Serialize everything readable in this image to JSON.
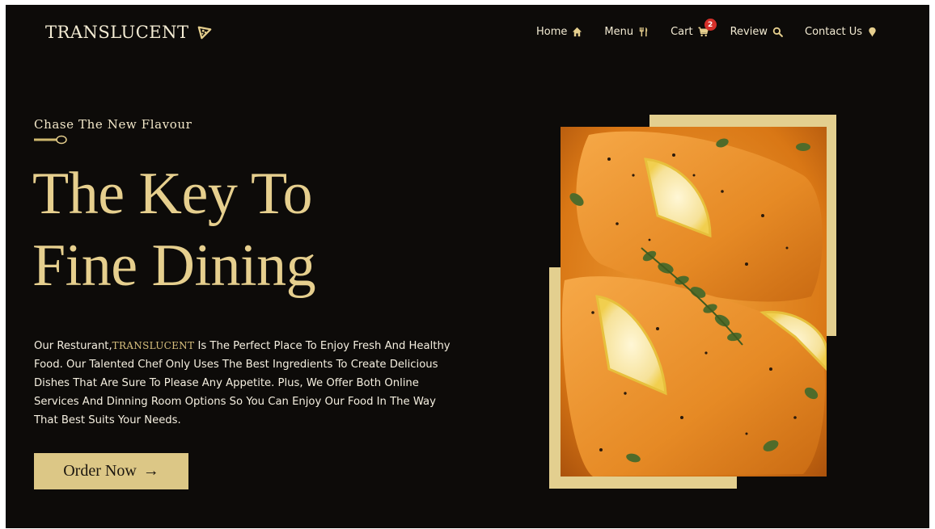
{
  "nav": {
    "logo_text": "TRANSLUCENT",
    "logo_icon": "pizza-slice-icon",
    "items": [
      {
        "label": "Home",
        "icon": "home-icon"
      },
      {
        "label": "Menu",
        "icon": "utensils-icon"
      },
      {
        "label": "Cart",
        "icon": "cart-icon",
        "badge": "2"
      },
      {
        "label": "Review",
        "icon": "search-icon"
      },
      {
        "label": "Contact Us",
        "icon": "location-pin-icon"
      }
    ]
  },
  "hero": {
    "tagline": "Chase The New Flavour",
    "headline_line1": "The Key To",
    "headline_line2": "Fine Dining",
    "description_prefix": "Our Resturant,",
    "description_brand": "TRANSLUCENT",
    "description_rest": " Is The Perfect Place To Enjoy Fresh And Healthy Food. Our Talented Chef Only Uses The Best Ingredients To Create Delicious Dishes That Are Sure To Please Any Appetite. Plus, We Offer Both Online Services And Dinning Room Options So You Can Enjoy Our Food In The Way That Best Suits Your Needs.",
    "cta_label": "Order Now",
    "cta_arrow": "→"
  },
  "colors": {
    "background": "#0d0b09",
    "accent_gold": "#e6cf8e",
    "button_bg": "#dcc786",
    "badge_red": "#d5302a"
  }
}
